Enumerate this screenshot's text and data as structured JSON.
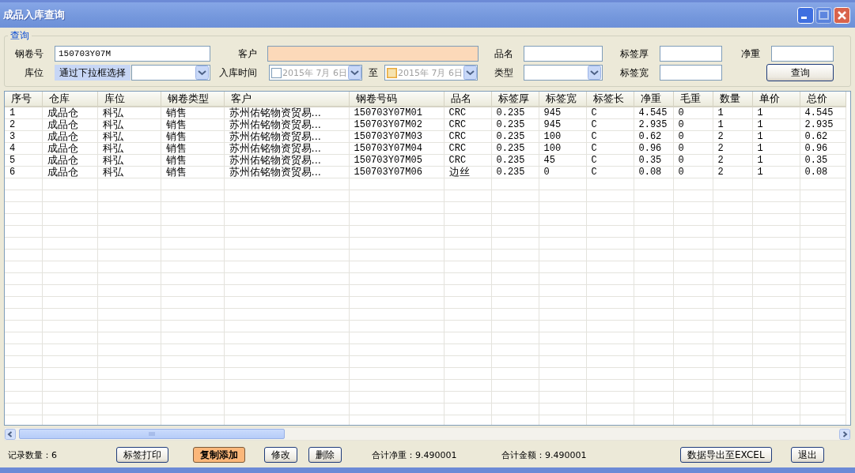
{
  "window": {
    "title": "成品入库查询",
    "controls": [
      {
        "kind": "minimize",
        "disabled": false
      },
      {
        "kind": "maximize",
        "disabled": true
      },
      {
        "kind": "close",
        "disabled": false
      }
    ]
  },
  "query": {
    "legend": "查询",
    "rows": [
      {
        "fields": [
          {
            "kind": "text",
            "label": "钢卷号",
            "value": "150703Y07M",
            "highlighted": false
          },
          {
            "kind": "text",
            "label": "客户",
            "highlighted": true
          },
          {
            "kind": "text",
            "label": "品名",
            "highlighted": false
          },
          {
            "kind": "text",
            "label": "标签厚",
            "highlighted": false
          },
          {
            "kind": "text",
            "label": "净重",
            "highlighted": false
          }
        ]
      },
      {
        "fields": [
          {
            "kind": "combo",
            "label": "库位",
            "hint": "通过下拉框选择"
          },
          {
            "kind": "daterange",
            "label": "入库时间",
            "separator": "至",
            "from": {
              "value": "2015年 7月 6日",
              "checked": false,
              "hover": false
            },
            "to": {
              "value": "2015年 7月 6日",
              "checked": false,
              "hover": true
            }
          },
          {
            "kind": "combo",
            "label": "类型"
          },
          {
            "kind": "text",
            "label": "标签宽",
            "highlighted": false
          },
          {
            "kind": "button",
            "label": "查询"
          }
        ]
      }
    ]
  },
  "table": {
    "columns": [
      "序号",
      "仓库",
      "库位",
      "钢卷类型",
      "客户",
      "钢卷号码",
      "品名",
      "标签厚",
      "标签宽",
      "标签长",
      "净重",
      "毛重",
      "数量",
      "单价",
      "总价"
    ],
    "rows": [
      [
        "1",
        "成品仓",
        "科弘",
        "销售",
        "苏州佑铭物资贸易...",
        "150703Y07M01",
        "CRC",
        "0.235",
        "945",
        "C",
        "4.545",
        "0",
        "1",
        "1",
        "4.545"
      ],
      [
        "2",
        "成品仓",
        "科弘",
        "销售",
        "苏州佑铭物资贸易...",
        "150703Y07M02",
        "CRC",
        "0.235",
        "945",
        "C",
        "2.935",
        "0",
        "1",
        "1",
        "2.935"
      ],
      [
        "3",
        "成品仓",
        "科弘",
        "销售",
        "苏州佑铭物资贸易...",
        "150703Y07M03",
        "CRC",
        "0.235",
        "100",
        "C",
        "0.62",
        "0",
        "2",
        "1",
        "0.62"
      ],
      [
        "4",
        "成品仓",
        "科弘",
        "销售",
        "苏州佑铭物资贸易...",
        "150703Y07M04",
        "CRC",
        "0.235",
        "100",
        "C",
        "0.96",
        "0",
        "2",
        "1",
        "0.96"
      ],
      [
        "5",
        "成品仓",
        "科弘",
        "销售",
        "苏州佑铭物资贸易...",
        "150703Y07M05",
        "CRC",
        "0.235",
        "45",
        "C",
        "0.35",
        "0",
        "2",
        "1",
        "0.35"
      ],
      [
        "6",
        "成品仓",
        "科弘",
        "销售",
        "苏州佑铭物资贸易...",
        "150703Y07M06",
        "边丝",
        "0.235",
        "0",
        "C",
        "0.08",
        "0",
        "2",
        "1",
        "0.08"
      ]
    ]
  },
  "footer": [
    {
      "kind": "text",
      "text": "记录数量：6"
    },
    {
      "kind": "button",
      "text": "标签打印",
      "highlighted": false
    },
    {
      "kind": "button",
      "text": "复制添加",
      "highlighted": true
    },
    {
      "kind": "button",
      "text": "修改",
      "highlighted": false
    },
    {
      "kind": "button",
      "text": "删除",
      "highlighted": false
    },
    {
      "kind": "text",
      "text": "合计净重：9.490001"
    },
    {
      "kind": "text",
      "text": "合计金额：9.490001"
    },
    {
      "kind": "button",
      "text": "数据导出至EXCEL",
      "highlighted": false
    },
    {
      "kind": "button",
      "text": "退出",
      "highlighted": false
    }
  ]
}
